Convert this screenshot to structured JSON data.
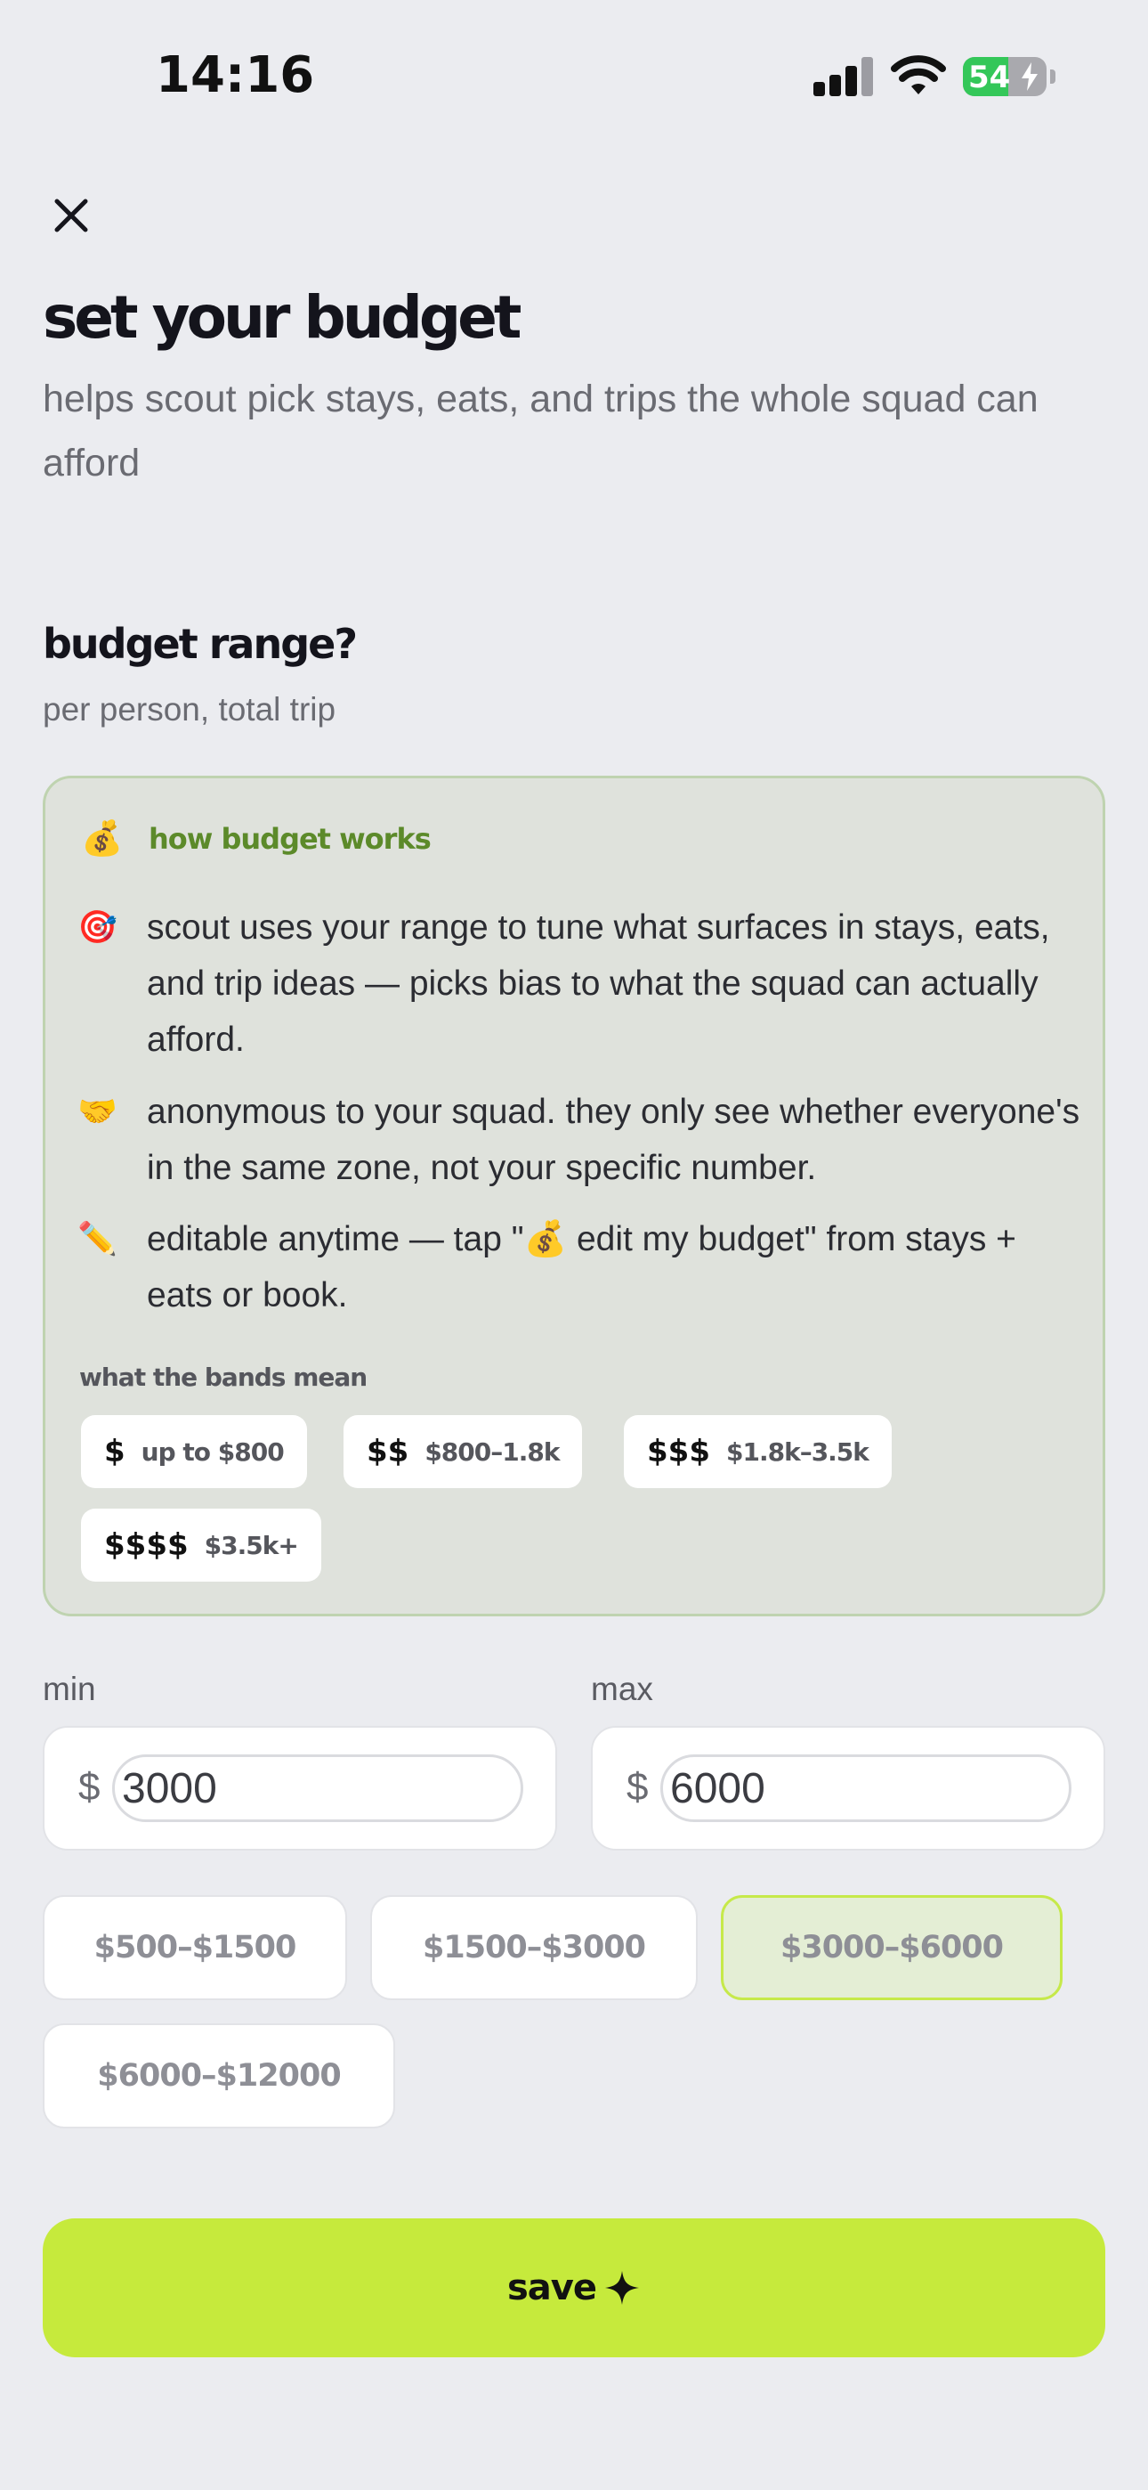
{
  "status_bar": {
    "time": "14:16",
    "battery": "54",
    "battery_level": 0.54
  },
  "header": {
    "title": "set your budget",
    "subtitle": "helps scout pick stays, eats, and trips the whole squad can afford"
  },
  "section": {
    "title": "budget range?",
    "subtitle": "per person, total trip"
  },
  "info": {
    "icon": "💰",
    "title": "how budget works",
    "items": [
      {
        "icon": "🎯",
        "text": "scout uses your range to tune what surfaces in stays, eats, and trip ideas — picks bias to what the squad can actually afford."
      },
      {
        "icon": "🤝",
        "text": "anonymous to your squad. they only see whether everyone's in the same zone, not your specific number."
      },
      {
        "icon": "✏️",
        "text": "editable anytime — tap \"💰  edit my budget\" from stays + eats or book."
      }
    ],
    "bands_label": "what the bands mean",
    "bands": [
      {
        "symbol": "$",
        "range": "up to $800"
      },
      {
        "symbol": "$$",
        "range": "$800–1.8k"
      },
      {
        "symbol": "$$$",
        "range": "$1.8k–3.5k"
      },
      {
        "symbol": "$$$$",
        "range": "$3.5k+"
      }
    ]
  },
  "min": {
    "label": "min",
    "currency": "$",
    "value": "3000"
  },
  "max": {
    "label": "max",
    "currency": "$",
    "value": "6000"
  },
  "presets": [
    {
      "label": "$500–$1500",
      "selected": false
    },
    {
      "label": "$1500–$3000",
      "selected": false
    },
    {
      "label": "$3000–$6000",
      "selected": true
    },
    {
      "label": "$6000–$12000",
      "selected": false
    }
  ],
  "save": {
    "label": "save"
  },
  "colors": {
    "accent": "#C6EA3C",
    "info_title": "#5C8A2A",
    "background": "#EBECF0"
  }
}
